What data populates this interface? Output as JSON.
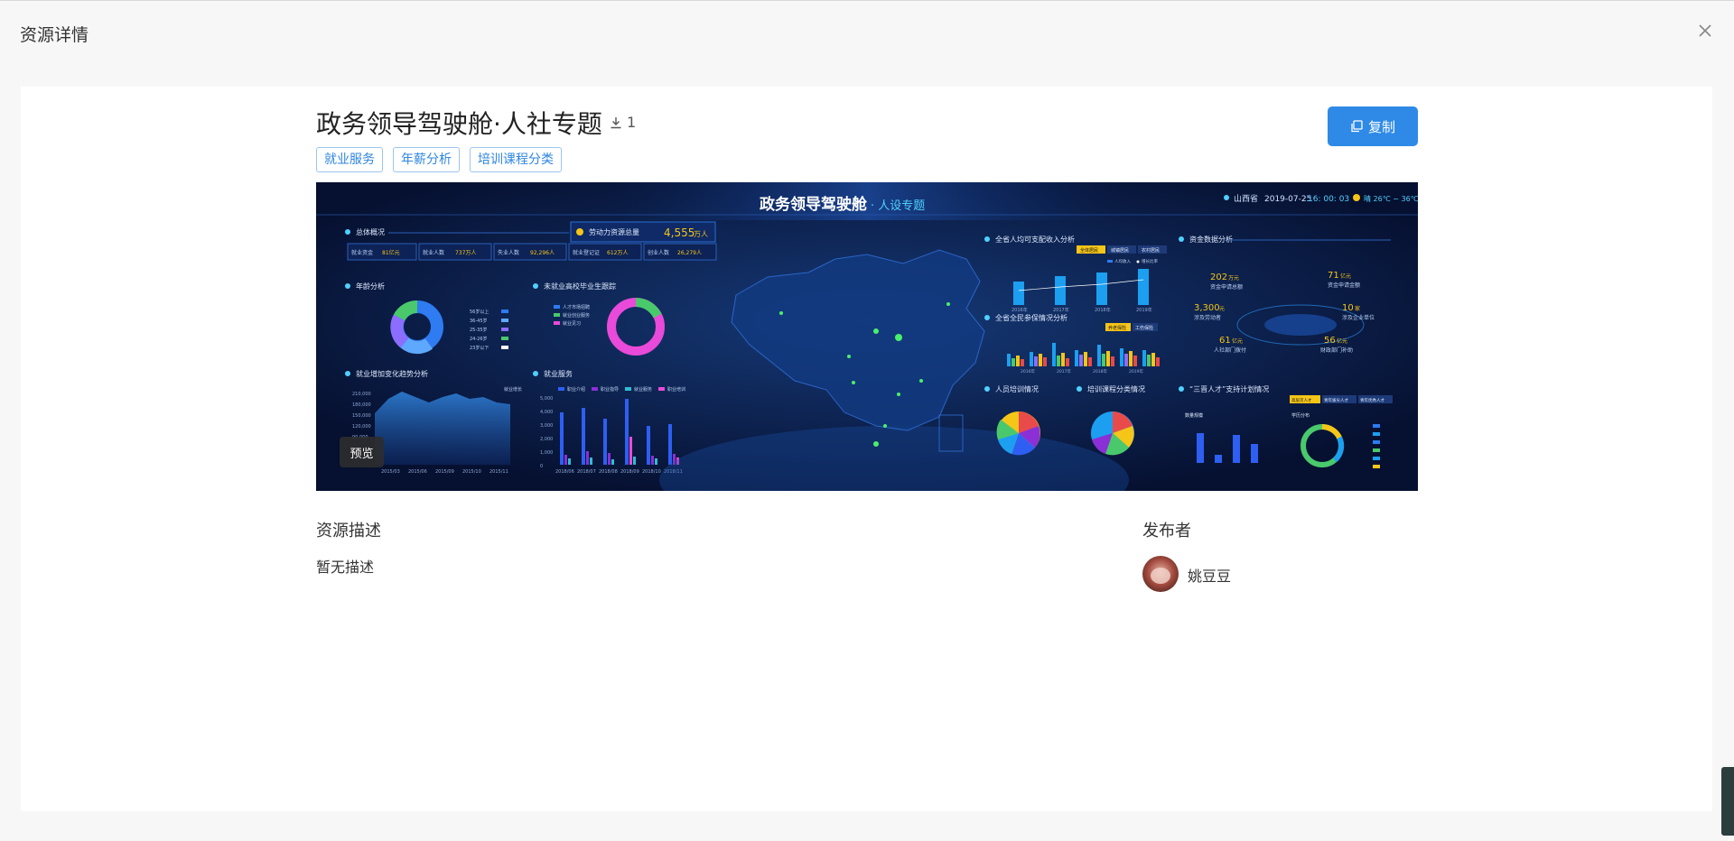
{
  "header": {
    "title": "资源详情",
    "close_icon": "close-icon"
  },
  "resource": {
    "title": "政务领导驾驶舱·人社专题",
    "downloads": "1",
    "tags": [
      "就业服务",
      "年薪分析",
      "培训课程分类"
    ],
    "copy_label": "复制",
    "preview_label": "预览"
  },
  "dashboard": {
    "title": "政务领导驾驶舱",
    "subtitle": "· 人设专题",
    "location": "山西省",
    "date": "2019-07-25",
    "time": "16: 00: 03",
    "weather": "晴 26℃ ~ 36℃",
    "panel_overview": "总体概况",
    "labor_label": "劳动力资源总量",
    "labor_value": "4,555",
    "labor_unit": "万人",
    "kpis": [
      {
        "label": "就业资金",
        "value": "81亿元"
      },
      {
        "label": "就业人数",
        "value": "737万人"
      },
      {
        "label": "失业人数",
        "value": "92,296人"
      },
      {
        "label": "就业登记证",
        "value": "612万人"
      },
      {
        "label": "创业人数",
        "value": "26,279人"
      }
    ],
    "panel_age": "年龄分析",
    "age_legend": [
      "56岁以上",
      "36-45岁",
      "25-35岁",
      "24-26岁",
      "23岁以下"
    ],
    "panel_graduates": "未就业高校毕业生跟踪",
    "grad_legend": [
      "人才市场招聘",
      "就业创业服务",
      "就业见习"
    ],
    "panel_trend": "就业增加变化趋势分析",
    "trend_legend": "就业增长",
    "trend_yticks": [
      "210,000",
      "180,000",
      "150,000",
      "120,000",
      "90,000"
    ],
    "trend_xticks": [
      "2015/03",
      "2015/06",
      "2015/09",
      "2015/10",
      "2015/11"
    ],
    "panel_service": "就业服务",
    "service_legend": [
      "职业介绍",
      "职业指导",
      "就业服务",
      "职业培训"
    ],
    "service_yticks": [
      "5,000",
      "4,000",
      "3,000",
      "2,000",
      "1,000",
      "0"
    ],
    "service_xticks": [
      "2018/06",
      "2018/07",
      "2018/08",
      "2018/09",
      "2018/10",
      "2018/11"
    ],
    "panel_income": "全省人均可支配收入分析",
    "income_tabs": [
      "全体居民",
      "城镇居民",
      "农村居民"
    ],
    "income_legend": [
      "人均收入",
      "增长比率"
    ],
    "income_years": [
      "2016年",
      "2017年",
      "2018年",
      "2019年"
    ],
    "panel_insurance": "全省全民参保情况分析",
    "insurance_tabs": [
      "养老保险",
      "工伤保险"
    ],
    "insurance_years": [
      "2016年",
      "2017年",
      "2018年",
      "2019年"
    ],
    "panel_training": "人员培训情况",
    "panel_course": "培训课程分类情况",
    "panel_funds": "资金数据分析",
    "funds": [
      {
        "value": "202",
        "unit": "万元",
        "label": "资金申请总额"
      },
      {
        "value": "71",
        "unit": "亿元",
        "label": "资金申请金额"
      },
      {
        "value": "3,300",
        "unit": "元",
        "label": "涉及劳动者"
      },
      {
        "value": "10",
        "unit": "家",
        "label": "涉及企业单位"
      },
      {
        "value": "61",
        "unit": "亿元",
        "label": "人社部门拨付"
      },
      {
        "value": "56",
        "unit": "亿元",
        "label": "财政部门补助"
      }
    ],
    "panel_talent": "“三晋人才”支持计划情况",
    "talent_tabs": [
      "高层次人才",
      "青年拔尖人才",
      "青年优秀人才"
    ],
    "talent_sub1": "数量规模",
    "talent_sub2": "学历分布"
  },
  "description": {
    "heading": "资源描述",
    "text": "暂无描述"
  },
  "publisher": {
    "heading": "发布者",
    "name": "姚豆豆"
  },
  "colors": {
    "accent": "#2e8ae6",
    "tag_border": "#9cc5ef",
    "dash_bg": "#071236",
    "dash_gold": "#f5c518",
    "dash_cyan": "#4fd1ff"
  }
}
